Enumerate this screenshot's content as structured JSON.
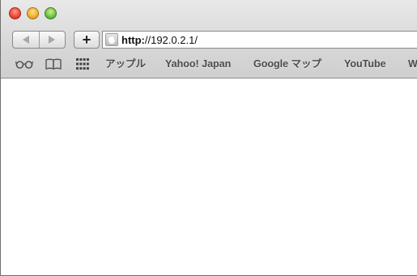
{
  "toolbar": {
    "address": {
      "scheme": "http:",
      "url_rest": "//192.0.2.1/"
    }
  },
  "bookmarks": {
    "items": [
      {
        "label": "アップル"
      },
      {
        "label": "Yahoo! Japan"
      },
      {
        "label": "Google マップ"
      },
      {
        "label": "YouTube"
      },
      {
        "label": "W"
      }
    ],
    "icons": [
      "reading-list-icon",
      "book-icon",
      "top-sites-grid-icon"
    ]
  },
  "colors": {
    "chrome_top": "#e9e9e9",
    "chrome_bottom": "#cfcfcf",
    "close": "#ee4b3b",
    "minimize": "#f4b330",
    "zoom": "#73c644",
    "bookmark_text": "#4b4b4b"
  }
}
